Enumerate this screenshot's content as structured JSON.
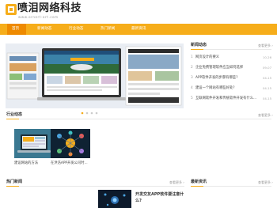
{
  "site": {
    "title": "喷泪网络科技",
    "subtitle": "www.ornert-art.com"
  },
  "nav": {
    "items": [
      {
        "label": "首页"
      },
      {
        "label": "新闻动态"
      },
      {
        "label": "行业动态"
      },
      {
        "label": "热门新闻"
      },
      {
        "label": "最新资讯"
      }
    ]
  },
  "news_panel": {
    "title": "新闻动态",
    "more": "查看更多 ›",
    "items": [
      {
        "num": "1",
        "text": "网页设计的要义",
        "date": "10-26"
      },
      {
        "num": "2",
        "text": "企业免费管理软件应当如何选择",
        "date": "09-07"
      },
      {
        "num": "3",
        "text": "APP软件开发的步骤有哪些?",
        "date": "04-15"
      },
      {
        "num": "4",
        "text": "建设一个网站有哪些好处?",
        "date": "04-15"
      },
      {
        "num": "5",
        "text": "互联网软件开发和传统软件开发有什么...",
        "date": "04-15"
      }
    ]
  },
  "industry_panel": {
    "title": "行业动态",
    "more": "查看更多 ›",
    "items": [
      {
        "caption": "建设网站的方法"
      },
      {
        "caption": "在洪浩APP开发公司时..."
      }
    ]
  },
  "hot_panel": {
    "title": "热门新闻",
    "more": "查看更多 ›",
    "feature_title": "开发交友APP软件要注意什么?"
  },
  "latest_panel": {
    "title": "最新资讯",
    "more": "查看更多 ›"
  },
  "colors": {
    "accent": "#f6ad1a",
    "accent_dark": "#ee8a00"
  }
}
